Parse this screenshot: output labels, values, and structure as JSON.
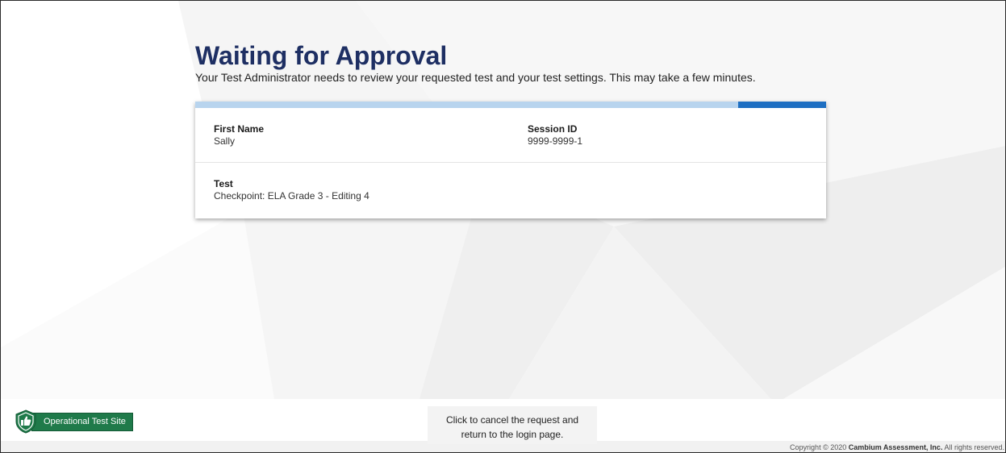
{
  "header": {
    "title": "Waiting for Approval",
    "subtitle": "Your Test Administrator needs to review your requested test and your test settings. This may take a few minutes."
  },
  "progress": {
    "value_fraction": 0.86,
    "track_color": "#b8d4ee",
    "fill_color": "#1e6fc2"
  },
  "details": {
    "first_name_label": "First Name",
    "first_name_value": "Sally",
    "session_id_label": "Session ID",
    "session_id_value": "9999-9999-1",
    "test_label": "Test",
    "test_value": "Checkpoint: ELA Grade 3 - Editing 4"
  },
  "footer": {
    "site_badge_label": "Operational Test Site",
    "site_badge_icon": "shield-thumbs-up-icon",
    "site_badge_color": "#1f7a4a",
    "cancel_line1": "Click to cancel the request and",
    "cancel_line2": "return to the login page.",
    "copyright_prefix": "Copyright © 2020",
    "copyright_company": "Cambium Assessment, Inc.",
    "copyright_suffix": "All rights reserved."
  },
  "colors": {
    "title": "#1e2f63",
    "accent": "#1e6fc2"
  }
}
